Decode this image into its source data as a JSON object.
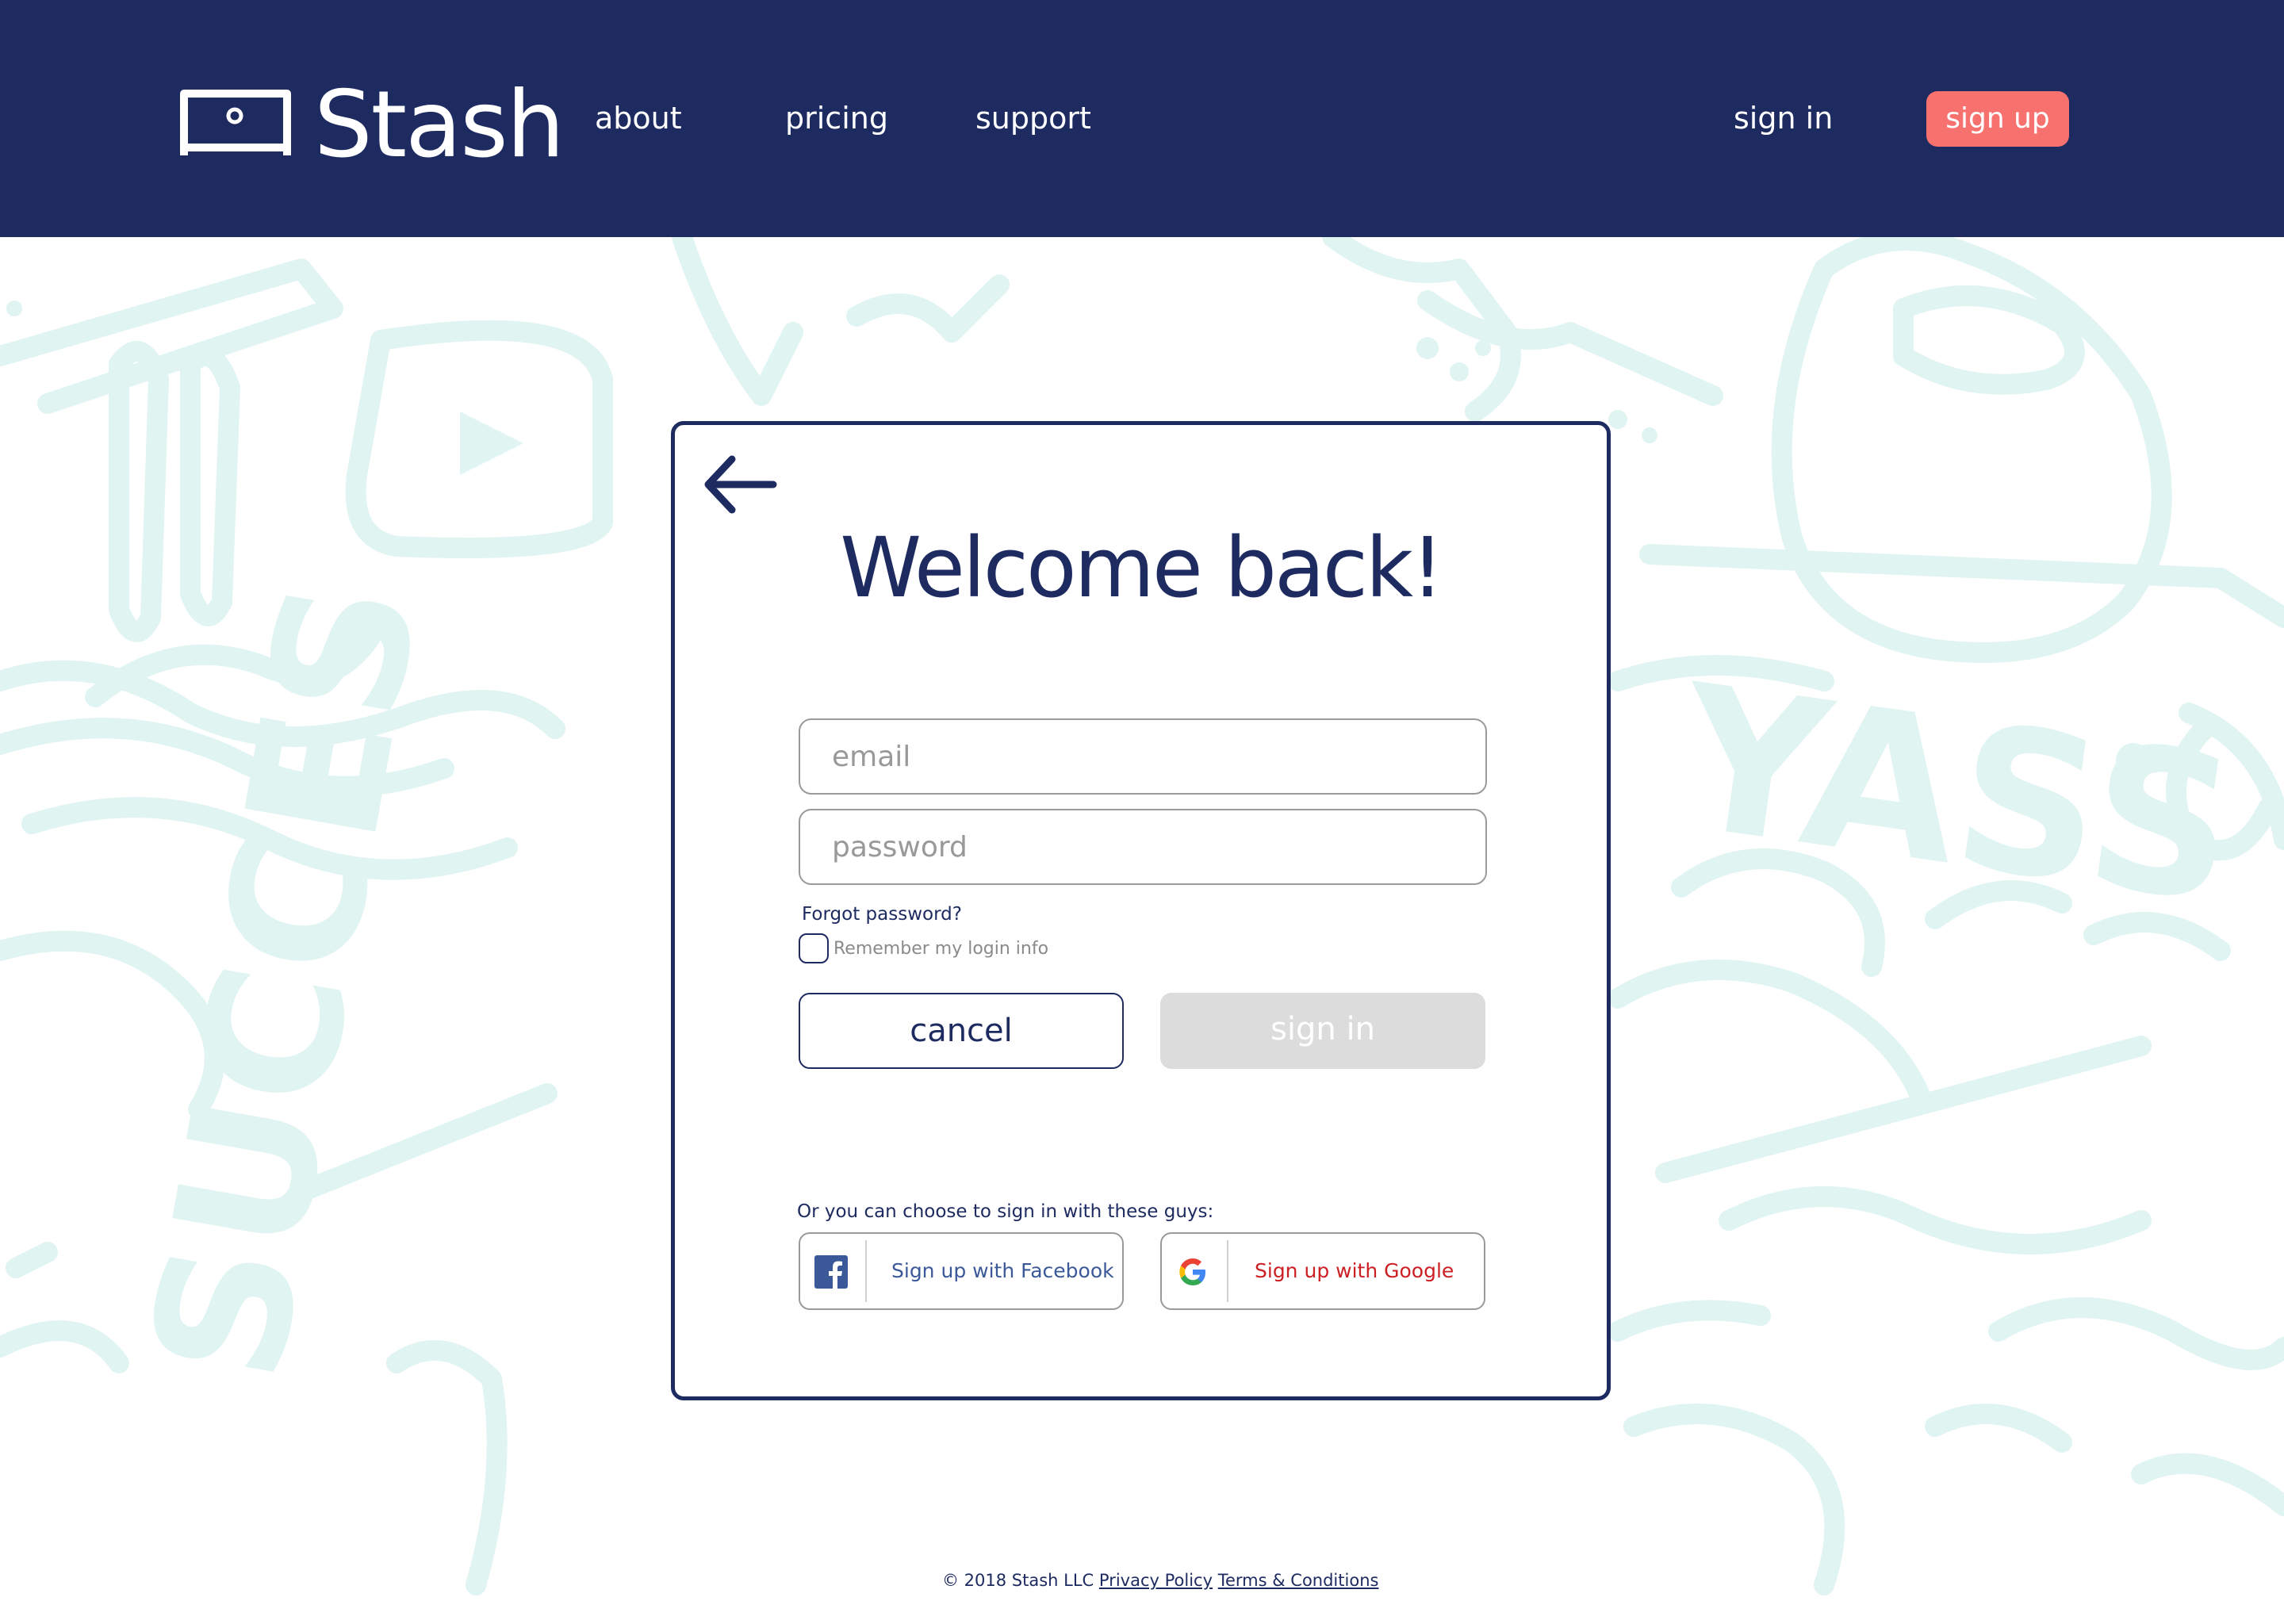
{
  "header": {
    "brand": "Stash",
    "nav": {
      "about": "about",
      "pricing": "pricing",
      "support": "support"
    },
    "sign_in": "sign in",
    "sign_up": "sign up"
  },
  "background": {
    "doodle_words": [
      "YASS",
      "SUCCES"
    ]
  },
  "card": {
    "title": "Welcome back!",
    "email_placeholder": "email",
    "password_placeholder": "password",
    "forgot_password": "Forgot password?",
    "remember_label": "Remember my login info",
    "remember_checked": false,
    "cancel_label": "cancel",
    "signin_label": "sign in",
    "social_prompt": "Or you can choose to sign in with these guys:",
    "facebook_label": "Sign up with Facebook",
    "google_label": "Sign up with Google"
  },
  "footer": {
    "copyright": "© 2018 Stash LLC",
    "privacy": "Privacy Policy",
    "terms": "Terms & Conditions"
  },
  "colors": {
    "navy": "#1e2b61",
    "coral": "#f7716f",
    "doodle": "#e0f4f2",
    "disabled": "#dcdcdc",
    "facebook": "#3b5998",
    "google_red": "#cc1f24"
  },
  "icons": {
    "logo": "tv-frame-icon",
    "back": "arrow-left-icon",
    "facebook": "facebook-icon",
    "google": "google-icon"
  }
}
